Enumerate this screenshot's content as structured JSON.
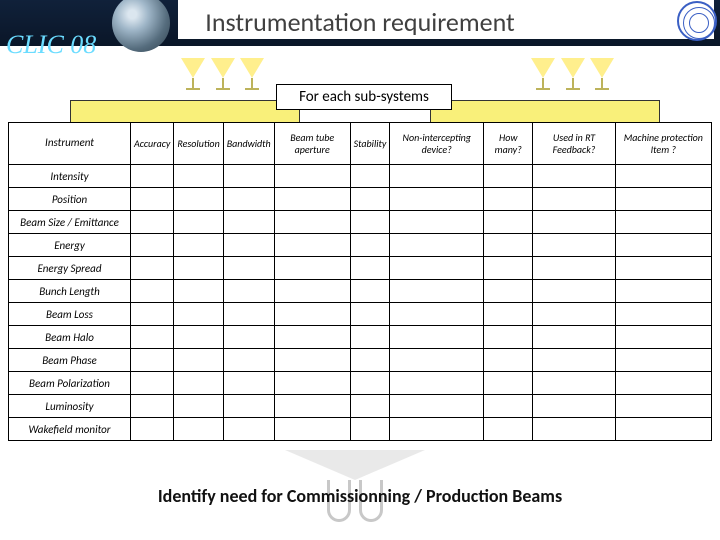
{
  "header": {
    "title": "Instrumentation requirement",
    "conference": "CLIC 08"
  },
  "subhdr": "For each sub-systems",
  "table": {
    "columns": [
      "Instrument",
      "Accuracy",
      "Resolution",
      "Bandwidth",
      "Beam tube aperture",
      "Stability",
      "Non-intercepting device?",
      "How many?",
      "Used in RT Feedback?",
      "Machine protection Item ?"
    ],
    "rows": [
      "Intensity",
      "Position",
      "Beam Size / Emittance",
      "Energy",
      "Energy Spread",
      "Bunch Length",
      "Beam Loss",
      "Beam Halo",
      "Beam Phase",
      "Beam Polarization",
      "Luminosity",
      "Wakefield monitor"
    ]
  },
  "footer_note": "Identify need for Commissionning / Production Beams"
}
